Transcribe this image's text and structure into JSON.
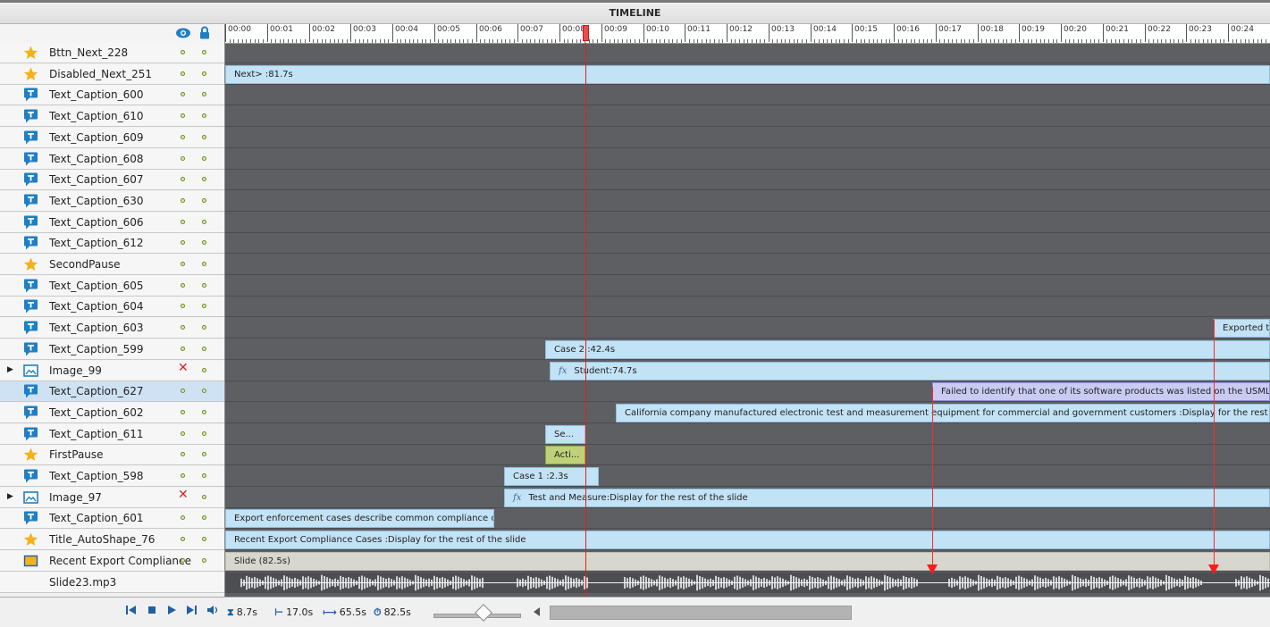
{
  "window": {
    "title": "TIMELINE"
  },
  "header_icons": {
    "visibility": "eye-icon",
    "lock": "lock-icon"
  },
  "colors": {
    "accent": "#1f7fc4",
    "star": "#f3b21b",
    "bar": "#c2e2f6",
    "selected_bar": "#c9cbf3",
    "pause_bar": "#bfd27a",
    "playhead": "#e02020",
    "timeline_bg": "#5e5f63"
  },
  "ruler": {
    "labels": [
      "00:00",
      "00:01",
      "00:02",
      "00:03",
      "00:04",
      "00:05",
      "00:06",
      "00:07",
      "00:08",
      "00:09",
      "00:10",
      "00:11",
      "00:12",
      "00:13",
      "00:14",
      "00:15",
      "00:16",
      "00:17",
      "00:18",
      "00:19",
      "00:20",
      "00:21",
      "00:22",
      "00:23",
      "00:24"
    ]
  },
  "layers": [
    {
      "name": "Bttn_Next_228",
      "icon": "star-icon",
      "expandable": false,
      "selected": false,
      "visible": true
    },
    {
      "name": "Disabled_Next_251",
      "icon": "star-icon",
      "expandable": false,
      "selected": false,
      "visible": true
    },
    {
      "name": "Text_Caption_600",
      "icon": "caption-icon",
      "expandable": false,
      "selected": false,
      "visible": true
    },
    {
      "name": "Text_Caption_610",
      "icon": "caption-icon",
      "expandable": false,
      "selected": false,
      "visible": true
    },
    {
      "name": "Text_Caption_609",
      "icon": "caption-icon",
      "expandable": false,
      "selected": false,
      "visible": true
    },
    {
      "name": "Text_Caption_608",
      "icon": "caption-icon",
      "expandable": false,
      "selected": false,
      "visible": true
    },
    {
      "name": "Text_Caption_607",
      "icon": "caption-icon",
      "expandable": false,
      "selected": false,
      "visible": true
    },
    {
      "name": "Text_Caption_630",
      "icon": "caption-icon",
      "expandable": false,
      "selected": false,
      "visible": true
    },
    {
      "name": "Text_Caption_606",
      "icon": "caption-icon",
      "expandable": false,
      "selected": false,
      "visible": true
    },
    {
      "name": "Text_Caption_612",
      "icon": "caption-icon",
      "expandable": false,
      "selected": false,
      "visible": true
    },
    {
      "name": "SecondPause",
      "icon": "star-icon",
      "expandable": false,
      "selected": false,
      "visible": true
    },
    {
      "name": "Text_Caption_605",
      "icon": "caption-icon",
      "expandable": false,
      "selected": false,
      "visible": true
    },
    {
      "name": "Text_Caption_604",
      "icon": "caption-icon",
      "expandable": false,
      "selected": false,
      "visible": true
    },
    {
      "name": "Text_Caption_603",
      "icon": "caption-icon",
      "expandable": false,
      "selected": false,
      "visible": true
    },
    {
      "name": "Text_Caption_599",
      "icon": "caption-icon",
      "expandable": false,
      "selected": false,
      "visible": true
    },
    {
      "name": "Image_99",
      "icon": "image-icon",
      "expandable": true,
      "selected": false,
      "visible": false
    },
    {
      "name": "Text_Caption_627",
      "icon": "caption-icon",
      "expandable": false,
      "selected": true,
      "visible": true
    },
    {
      "name": "Text_Caption_602",
      "icon": "caption-icon",
      "expandable": false,
      "selected": false,
      "visible": true
    },
    {
      "name": "Text_Caption_611",
      "icon": "caption-icon",
      "expandable": false,
      "selected": false,
      "visible": true
    },
    {
      "name": "FirstPause",
      "icon": "star-icon",
      "expandable": false,
      "selected": false,
      "visible": true
    },
    {
      "name": "Text_Caption_598",
      "icon": "caption-icon",
      "expandable": false,
      "selected": false,
      "visible": true
    },
    {
      "name": "Image_97",
      "icon": "image-icon",
      "expandable": true,
      "selected": false,
      "visible": false
    },
    {
      "name": "Text_Caption_601",
      "icon": "caption-icon",
      "expandable": false,
      "selected": false,
      "visible": true
    },
    {
      "name": "Title_AutoShape_76",
      "icon": "star-icon",
      "expandable": false,
      "selected": false,
      "visible": true
    },
    {
      "name": "Recent Export Compliance...",
      "icon": "slide-icon",
      "expandable": false,
      "selected": false,
      "visible": true
    },
    {
      "name": "Slide23.mp3",
      "icon": "",
      "expandable": false,
      "selected": false,
      "visible": null
    }
  ],
  "bars": {
    "disabled_next": "Next> :81.7s",
    "caption_603": "Exported th",
    "caption_599": "Case 2 :42.4s",
    "image_99": "Student:74.7s",
    "caption_627": "Failed to identify that one of its software products was listed on the USML and s",
    "caption_602": "California company manufactured electronic test and measurement equipment for commercial and government customers :Display for the rest of the slide",
    "caption_611": "Se...",
    "first_pause": "Acti...",
    "caption_598": "Case 1 :2.3s",
    "image_97": "Test and Measure:Display for the rest of the slide",
    "caption_601": "Export enforcement cases describe common compliance c...",
    "title_autoshape": "Recent Export Compliance Cases :Display for the rest of the slide",
    "slide": "Slide (82.5s)",
    "fx": "fx"
  },
  "playhead_time": "00:08",
  "footer": {
    "controls": [
      "rewind-icon",
      "stop-icon",
      "play-icon",
      "next-icon",
      "audio-icon"
    ],
    "current_time": "8.7s",
    "start_time": "17.0s",
    "duration": "65.5s",
    "total": "82.5s"
  }
}
